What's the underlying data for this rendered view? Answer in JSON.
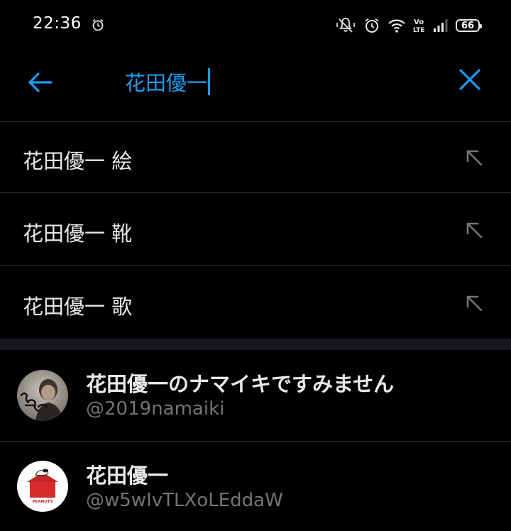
{
  "status_bar": {
    "time": "22:36",
    "battery": "66",
    "network": "Vo LTE",
    "icons": [
      "alarm-icon",
      "mute-icon",
      "alarm-icon",
      "wifi-icon",
      "volte-icon",
      "signal-icon",
      "battery-icon"
    ]
  },
  "search": {
    "query": "花田優一"
  },
  "suggestions": [
    {
      "label": "花田優一 絵",
      "icon": "fill-query-arrow-icon"
    },
    {
      "label": "花田優一 靴",
      "icon": "fill-query-arrow-icon"
    },
    {
      "label": "花田優一 歌",
      "icon": "fill-query-arrow-icon"
    }
  ],
  "users": [
    {
      "name": "花田優一のナマイキですみません",
      "handle": "@2019namaiki",
      "avatar": "avatar-photo"
    },
    {
      "name": "花田優一",
      "handle": "@w5wIvTLXoLEddaW",
      "avatar": "avatar-peanuts-doghouse",
      "avatar_badge": "PEANUTS"
    }
  ],
  "colors": {
    "background": "#000000",
    "accent": "#1d9bf0",
    "primary_text": "#e7e9ea",
    "secondary_text": "#71767b",
    "divider": "#2f3336",
    "doghouse_red": "#d62b2b"
  }
}
